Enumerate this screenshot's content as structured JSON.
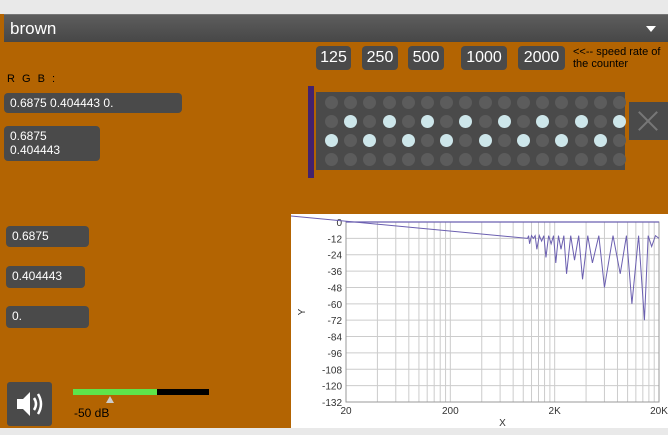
{
  "title": "brown",
  "speed_buttons": [
    "125",
    "250",
    "500",
    "1000",
    "2000"
  ],
  "speed_note": "<<-- speed rate of the counter",
  "rgb_label": "R G B :",
  "msg_full": "0.6875 0.404443 0.",
  "msg_pair": [
    "0.6875",
    "0.404443"
  ],
  "msg_r": "0.6875",
  "msg_g": "0.404443",
  "msg_b": "0.",
  "meter": {
    "level_label": "-50 dB",
    "fill_fraction": 0.62
  },
  "counter": {
    "rows": 4,
    "cols": 16,
    "lit": [
      [],
      [
        1,
        3,
        5,
        7,
        9,
        11,
        13,
        15
      ],
      [
        0,
        2,
        4,
        6,
        8,
        10,
        12,
        14
      ],
      []
    ]
  },
  "plot": {
    "ylabel": "Y",
    "xlabel": "X",
    "yticks": [
      "0",
      "-12",
      "-24",
      "-36",
      "-48",
      "-60",
      "-72",
      "-84",
      "-96",
      "-108",
      "-120",
      "-132"
    ],
    "xticks": [
      "20",
      "200",
      "2K",
      "20K"
    ]
  },
  "colors": {
    "background": "#b36402",
    "panel": "#4a4a4a",
    "lit_dot": "#cde6ea",
    "unlit_dot": "#5c5c5c",
    "curve": "#6b5fb0"
  },
  "icons": {
    "speaker": "speaker-icon",
    "close": "close-icon",
    "dropdown": "chevron-down-icon"
  }
}
